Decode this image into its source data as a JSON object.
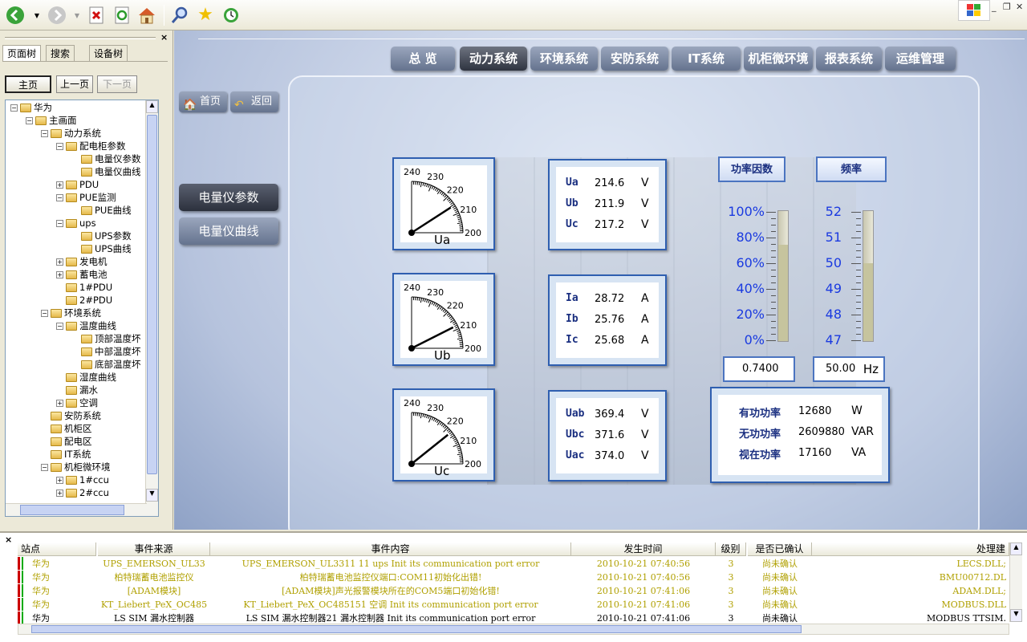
{
  "toolbar": {
    "icons": [
      "back-arrow-icon",
      "forward-arrow-icon",
      "stop-icon",
      "refresh-icon",
      "home-icon",
      "search-icon",
      "favorites-star-icon",
      "history-icon"
    ]
  },
  "left": {
    "tabs": [
      "页面树",
      "搜索",
      "设备树"
    ],
    "nav": {
      "home": "主页",
      "prev": "上一页",
      "next": "下一页"
    },
    "tree": [
      {
        "label": "华为",
        "level": 0,
        "exp": "−"
      },
      {
        "label": "主画面",
        "level": 1,
        "exp": "−"
      },
      {
        "label": "动力系统",
        "level": 2,
        "exp": "−"
      },
      {
        "label": "配电柜参数",
        "level": 3,
        "exp": "−"
      },
      {
        "label": "电量仪参数",
        "level": 4,
        "exp": ""
      },
      {
        "label": "电量仪曲线",
        "level": 4,
        "exp": ""
      },
      {
        "label": "PDU",
        "level": 3,
        "exp": "+"
      },
      {
        "label": "PUE监测",
        "level": 3,
        "exp": "−"
      },
      {
        "label": "PUE曲线",
        "level": 4,
        "exp": ""
      },
      {
        "label": "ups",
        "level": 3,
        "exp": "−"
      },
      {
        "label": "UPS参数",
        "level": 4,
        "exp": ""
      },
      {
        "label": "UPS曲线",
        "level": 4,
        "exp": ""
      },
      {
        "label": "发电机",
        "level": 3,
        "exp": "+"
      },
      {
        "label": "蓄电池",
        "level": 3,
        "exp": "+"
      },
      {
        "label": "1#PDU",
        "level": 3,
        "exp": ""
      },
      {
        "label": "2#PDU",
        "level": 3,
        "exp": ""
      },
      {
        "label": "环境系统",
        "level": 2,
        "exp": "−"
      },
      {
        "label": "温度曲线",
        "level": 3,
        "exp": "−"
      },
      {
        "label": "顶部温度坏",
        "level": 4,
        "exp": ""
      },
      {
        "label": "中部温度坏",
        "level": 4,
        "exp": ""
      },
      {
        "label": "底部温度坏",
        "level": 4,
        "exp": ""
      },
      {
        "label": "湿度曲线",
        "level": 3,
        "exp": ""
      },
      {
        "label": "漏水",
        "level": 3,
        "exp": ""
      },
      {
        "label": "空调",
        "level": 3,
        "exp": "+"
      },
      {
        "label": "安防系统",
        "level": 2,
        "exp": ""
      },
      {
        "label": "机柜区",
        "level": 2,
        "exp": ""
      },
      {
        "label": "配电区",
        "level": 2,
        "exp": ""
      },
      {
        "label": "IT系统",
        "level": 2,
        "exp": ""
      },
      {
        "label": "机柜微环境",
        "level": 2,
        "exp": "−"
      },
      {
        "label": "1#ccu",
        "level": 3,
        "exp": "+"
      },
      {
        "label": "2#ccu",
        "level": 3,
        "exp": "+"
      }
    ]
  },
  "tabs": [
    "总 览",
    "动力系统",
    "环境系统",
    "安防系统",
    "IT系统",
    "机柜微环境",
    "报表系统",
    "运维管理"
  ],
  "buttons": {
    "home": "首页",
    "back": "返回"
  },
  "side": {
    "params": "电量仪参数",
    "curve": "电量仪曲线"
  },
  "gauges": [
    {
      "name": "Ua",
      "value": 214.6
    },
    {
      "name": "Ub",
      "value": 211.9
    },
    {
      "name": "Uc",
      "value": 217.2
    }
  ],
  "gauge_scale": [
    "240",
    "230",
    "220",
    "210",
    "200"
  ],
  "voltage": [
    {
      "label": "Ua",
      "value": "214.6",
      "unit": "V"
    },
    {
      "label": "Ub",
      "value": "211.9",
      "unit": "V"
    },
    {
      "label": "Uc",
      "value": "217.2",
      "unit": "V"
    }
  ],
  "current": [
    {
      "label": "Ia",
      "value": "28.72",
      "unit": "A"
    },
    {
      "label": "Ib",
      "value": "25.76",
      "unit": "A"
    },
    {
      "label": "Ic",
      "value": "25.68",
      "unit": "A"
    }
  ],
  "line_voltage": [
    {
      "label": "Uab",
      "value": "369.4",
      "unit": "V"
    },
    {
      "label": "Ubc",
      "value": "371.6",
      "unit": "V"
    },
    {
      "label": "Uac",
      "value": "374.0",
      "unit": "V"
    }
  ],
  "pf": {
    "title": "功率因数",
    "scale": [
      "100%",
      "80%",
      "60%",
      "40%",
      "20%",
      "0%"
    ],
    "reading": "0.7400"
  },
  "freq": {
    "title": "频率",
    "scale": [
      "52",
      "51",
      "50",
      "49",
      "48",
      "47"
    ],
    "reading": "50.00",
    "unit": "Hz"
  },
  "power": [
    {
      "label": "有功功率",
      "value": "12680",
      "unit": "W"
    },
    {
      "label": "无功功率",
      "value": "2609880",
      "unit": "VAR"
    },
    {
      "label": "视在功率",
      "value": "17160",
      "unit": "VA"
    }
  ],
  "events": {
    "headers": [
      "站点",
      "事件来源",
      "事件内容",
      "发生时间",
      "级别",
      "是否已确认",
      "处理建"
    ],
    "rows": [
      {
        "site": "华为",
        "src": "UPS_EMERSON_UL33",
        "content": "UPS_EMERSON_UL3311 11 ups Init its communication port error",
        "time": "2010-10-21 07:40:56",
        "level": "3",
        "ack": "尚未确认",
        "handler": "LECS.DLL;",
        "color": "#b0a000"
      },
      {
        "site": "华为",
        "src": "柏特瑞蓄电池监控仪",
        "content": "柏特瑞蓄电池监控仪端口:COM11初始化出错!",
        "time": "2010-10-21 07:40:56",
        "level": "3",
        "ack": "尚未确认",
        "handler": "BMU00712.DL",
        "color": "#b0a000"
      },
      {
        "site": "华为",
        "src": "[ADAM模块]",
        "content": "[ADAM模块]声光报警模块所在的COM5端口初始化错!",
        "time": "2010-10-21 07:41:06",
        "level": "3",
        "ack": "尚未确认",
        "handler": "ADAM.DLL;",
        "color": "#b0a000"
      },
      {
        "site": "华为",
        "src": "KT_Liebert_PeX_OC485",
        "content": "KT_Liebert_PeX_OC485151 空调 Init its communication port error",
        "time": "2010-10-21 07:41:06",
        "level": "3",
        "ack": "尚未确认",
        "handler": "MODBUS.DLL",
        "color": "#b0a000"
      },
      {
        "site": "华为",
        "src": "LS SIM 漏水控制器",
        "content": "LS SIM 漏水控制器21 漏水控制器 Init its communication port error",
        "time": "2010-10-21 07:41:06",
        "level": "3",
        "ack": "尚未确认",
        "handler": "MODBUS TTSIM.",
        "color": "#000000"
      }
    ]
  }
}
